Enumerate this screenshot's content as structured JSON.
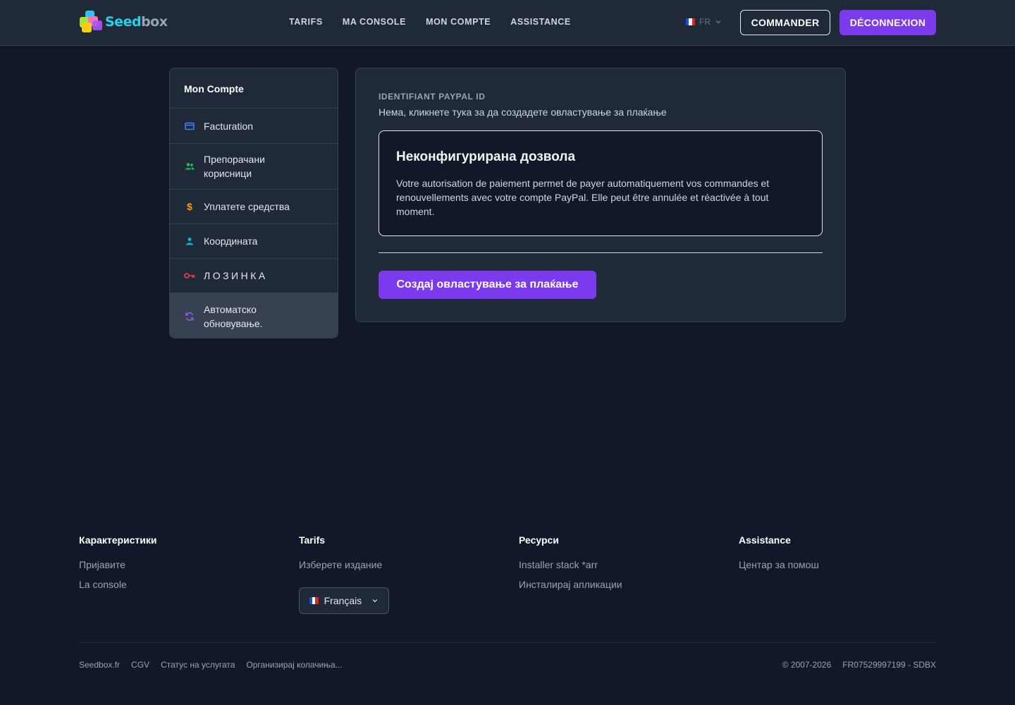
{
  "header": {
    "logo_text_a": "Seed",
    "logo_text_b": "box",
    "nav": [
      "TARIFS",
      "MA CONSOLE",
      "MON COMPTE",
      "ASSISTANCE"
    ],
    "lang": "FR",
    "order_label": "COMMANDER",
    "logout_label": "DÉCONNEXION"
  },
  "sidebar": {
    "title": "Mon Compte",
    "items": [
      {
        "label": "Facturation",
        "icon": "credit-card-icon",
        "color": "#3b82f6"
      },
      {
        "label": "Препорачани корисници",
        "icon": "users-icon",
        "color": "#22c55e"
      },
      {
        "label": "Уплатете средства",
        "icon": "dollar-icon",
        "color": "#f59e0b"
      },
      {
        "label": "Координата",
        "icon": "user-icon",
        "color": "#06b6d4"
      },
      {
        "label": "ЛОЗИНКА",
        "icon": "key-icon",
        "color": "#ef4444"
      },
      {
        "label": "Автоматско обновување.",
        "icon": "refresh-icon",
        "color": "#8b5cf6",
        "active": true
      }
    ]
  },
  "main": {
    "paypal_label": "IDENTIFIANT PAYPAL ID",
    "paypal_value": "Нема, кликнете тука за да создадете овластување за плаќање",
    "notice_title": "Неконфигурирана дозвола",
    "notice_text": "Votre autorisation de paiement permet de payer automatiquement vos commandes et renouvellements avec votre compte PayPal. Elle peut être annulée et réactivée à tout moment.",
    "create_button": "Создај овластување за плаќање"
  },
  "footer": {
    "columns": [
      {
        "title": "Карактеристики",
        "links": [
          "Пријавите",
          "La console"
        ]
      },
      {
        "title": "Tarifs",
        "links": [
          "Изберете издание"
        ]
      },
      {
        "title": "Ресурси",
        "links": [
          "Installer stack *arr",
          "Инсталирај апликации"
        ]
      },
      {
        "title": "Assistance",
        "links": [
          "Центар за помош"
        ]
      }
    ],
    "language": "Français",
    "bottom_links": [
      "Seedbox.fr",
      "CGV",
      "Статус на услугата",
      "Организирај колачиња..."
    ],
    "copyright": "© 2007-2026",
    "company_id": "FR07529997199 - SDBX"
  },
  "colors": {
    "accent": "#7c3aed",
    "background": "#111827",
    "surface": "#1f2937"
  }
}
